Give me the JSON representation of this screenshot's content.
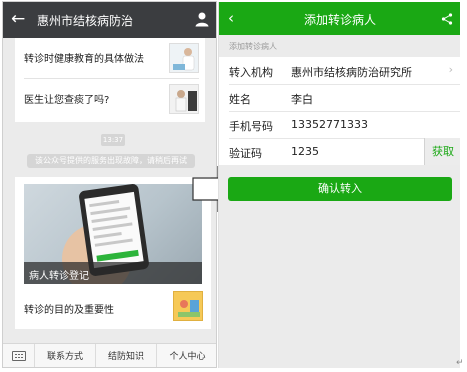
{
  "left_phone": {
    "header": {
      "back_icon": "arrow-left-icon",
      "title": "惠州市结核病防治",
      "profile_icon": "person-icon"
    },
    "articles_top": [
      {
        "title": "转诊时健康教育的具体做法",
        "thumb_icon": "doctor-thumbnail"
      },
      {
        "title": "医生让您查痰了吗?",
        "thumb_icon": "lab-thumbnail"
      }
    ],
    "timestamp": "13:37",
    "system_notice": "该公众号提供的服务出现故障，请稍后再试",
    "cover": {
      "caption": "病人转诊登记"
    },
    "article_bottom": {
      "title": "转诊的目的及重要性"
    },
    "footer": {
      "keyboard_icon": "keyboard-icon",
      "menus": [
        "联系方式",
        "结防知识",
        "个人中心"
      ]
    }
  },
  "arrow_icon": "right-arrow-icon",
  "right_phone": {
    "header": {
      "back_icon": "chevron-left-icon",
      "title": "添加转诊病人",
      "share_icon": "share-icon"
    },
    "section_label": "添加转诊病人",
    "form": {
      "institution": {
        "label": "转入机构",
        "value": "惠州市结核病防治研究所"
      },
      "name": {
        "label": "姓名",
        "value": "李白"
      },
      "phone": {
        "label": "手机号码",
        "value": "13352771333"
      },
      "code": {
        "label": "验证码",
        "value": "1235",
        "button": "获取"
      }
    },
    "confirm_button": "确认转入"
  },
  "colors": {
    "wechat_header": "#3b3d40",
    "accent_green": "#1aa814",
    "page_bg": "#ebebeb"
  },
  "return_glyph": "↵"
}
